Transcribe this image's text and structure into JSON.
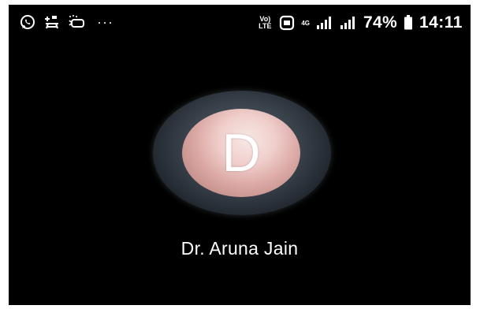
{
  "status_bar": {
    "left_icons": [
      "whatsapp-icon",
      "sync-notification-icon",
      "screen-cast-icon"
    ],
    "overflow_indicator": "···",
    "volte_label": "Vo)\nLTE",
    "network_type": "4G",
    "battery_percent": "74%",
    "time": "14:11"
  },
  "contact": {
    "initial": "D",
    "name": "Dr. Aruna Jain"
  },
  "colors": {
    "background": "#000000",
    "text": "#ffffff",
    "avatar_accent": "#dcaaa6"
  }
}
